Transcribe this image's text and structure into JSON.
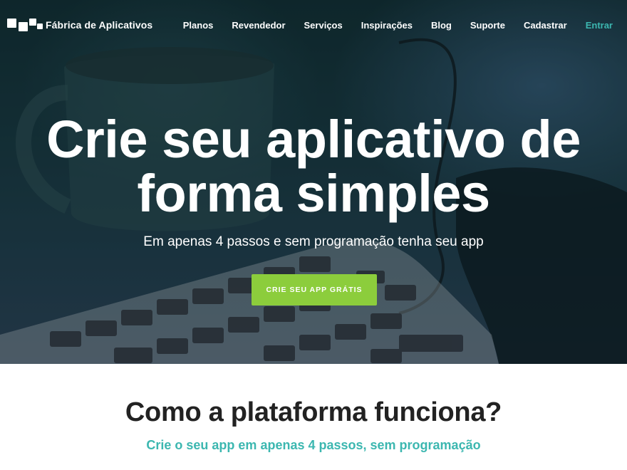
{
  "brand": {
    "name": "Fábrica de Aplicativos",
    "logo_icon": "blocks-logo-icon"
  },
  "nav": {
    "items": [
      {
        "label": "Planos"
      },
      {
        "label": "Revendedor"
      },
      {
        "label": "Serviços"
      },
      {
        "label": "Inspirações"
      },
      {
        "label": "Blog"
      },
      {
        "label": "Suporte"
      },
      {
        "label": "Cadastrar"
      },
      {
        "label": "Entrar"
      }
    ]
  },
  "hero": {
    "title_line1": "Crie seu aplicativo de",
    "title_line2": "forma simples",
    "subtitle": "Em apenas 4 passos e sem programação tenha seu app",
    "cta_label": "CRIE SEU APP GRÁTIS",
    "background": "photo of mug and keyboard on desk"
  },
  "section": {
    "title": "Como a plataforma funciona?",
    "subtitle": "Crie o seu app em apenas 4 passos, sem programação"
  },
  "colors": {
    "accent_teal": "#3cb7b0",
    "cta_green": "#8ccd3c",
    "heading_dark": "#222222"
  }
}
